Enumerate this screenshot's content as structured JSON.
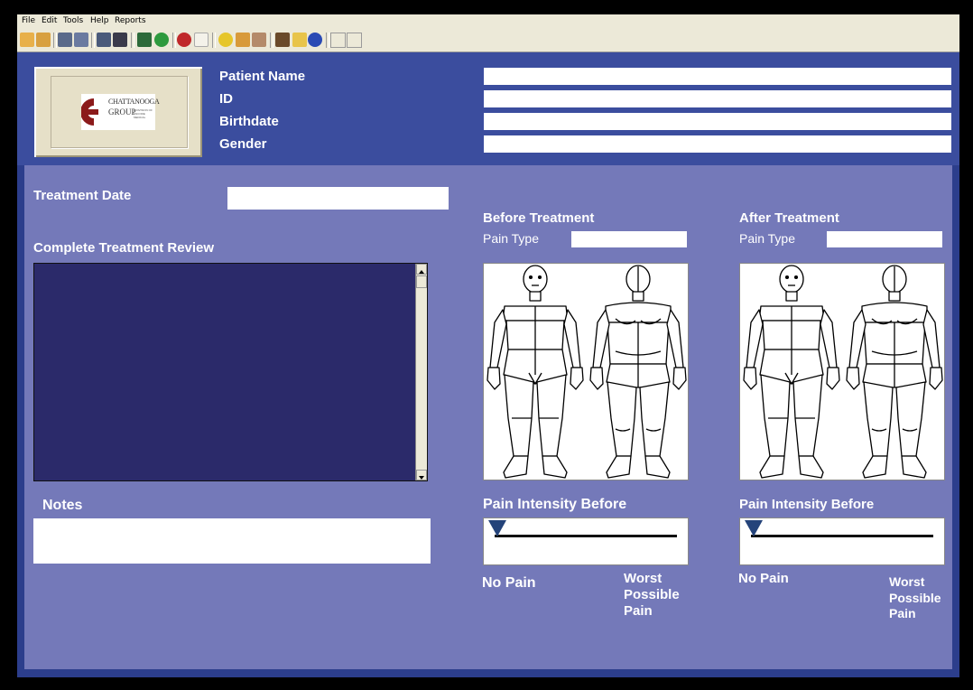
{
  "menu": [
    "File",
    "Edit",
    "Tools",
    "Help",
    "Reports"
  ],
  "toolbar_icons": [
    "new-icon",
    "open-icon",
    "print-preview-icon",
    "print-icon",
    "fax-icon",
    "scanner-icon",
    "save-icon",
    "export-icon",
    "mouth-icon",
    "blank-icon",
    "smiley-icon",
    "hand-icon",
    "notes-icon",
    "tools-icon",
    "help-icon",
    "info-icon"
  ],
  "header": {
    "logo": {
      "line1": "CHATTANOOGA",
      "line2": "GROUP",
      "tag": "A DIVISION OF ENCORE MEDICAL"
    },
    "fields": [
      {
        "label": "Patient Name",
        "value": ""
      },
      {
        "label": "ID",
        "value": ""
      },
      {
        "label": "Birthdate",
        "value": ""
      },
      {
        "label": "Gender",
        "value": ""
      }
    ]
  },
  "form": {
    "treatment_date": {
      "label": "Treatment Date",
      "value": ""
    },
    "review_label": "Complete Treatment Review",
    "notes_label": "Notes",
    "before": {
      "title": "Before Treatment",
      "pain_type_label": "Pain Type",
      "pain_type_value": "",
      "intensity_label": "Pain Intensity Before",
      "intensity_value": 0,
      "no_pain": "No Pain",
      "worst_line1": "Worst",
      "worst_line2": "Possible",
      "worst_line3": "Pain"
    },
    "after": {
      "title": "After Treatment",
      "pain_type_label": "Pain Type",
      "pain_type_value": "",
      "intensity_label": "Pain Intensity Before",
      "intensity_value": 0,
      "no_pain": "No Pain",
      "worst_line1": "Worst",
      "worst_line2": "Possible",
      "worst_line3": "Pain"
    }
  },
  "colors": {
    "frame": "#2c3e8c",
    "panel": "#7479b9",
    "review": "#2b2a6a",
    "slider_thumb": "#24437a",
    "logo_red": "#8b1a1a"
  }
}
